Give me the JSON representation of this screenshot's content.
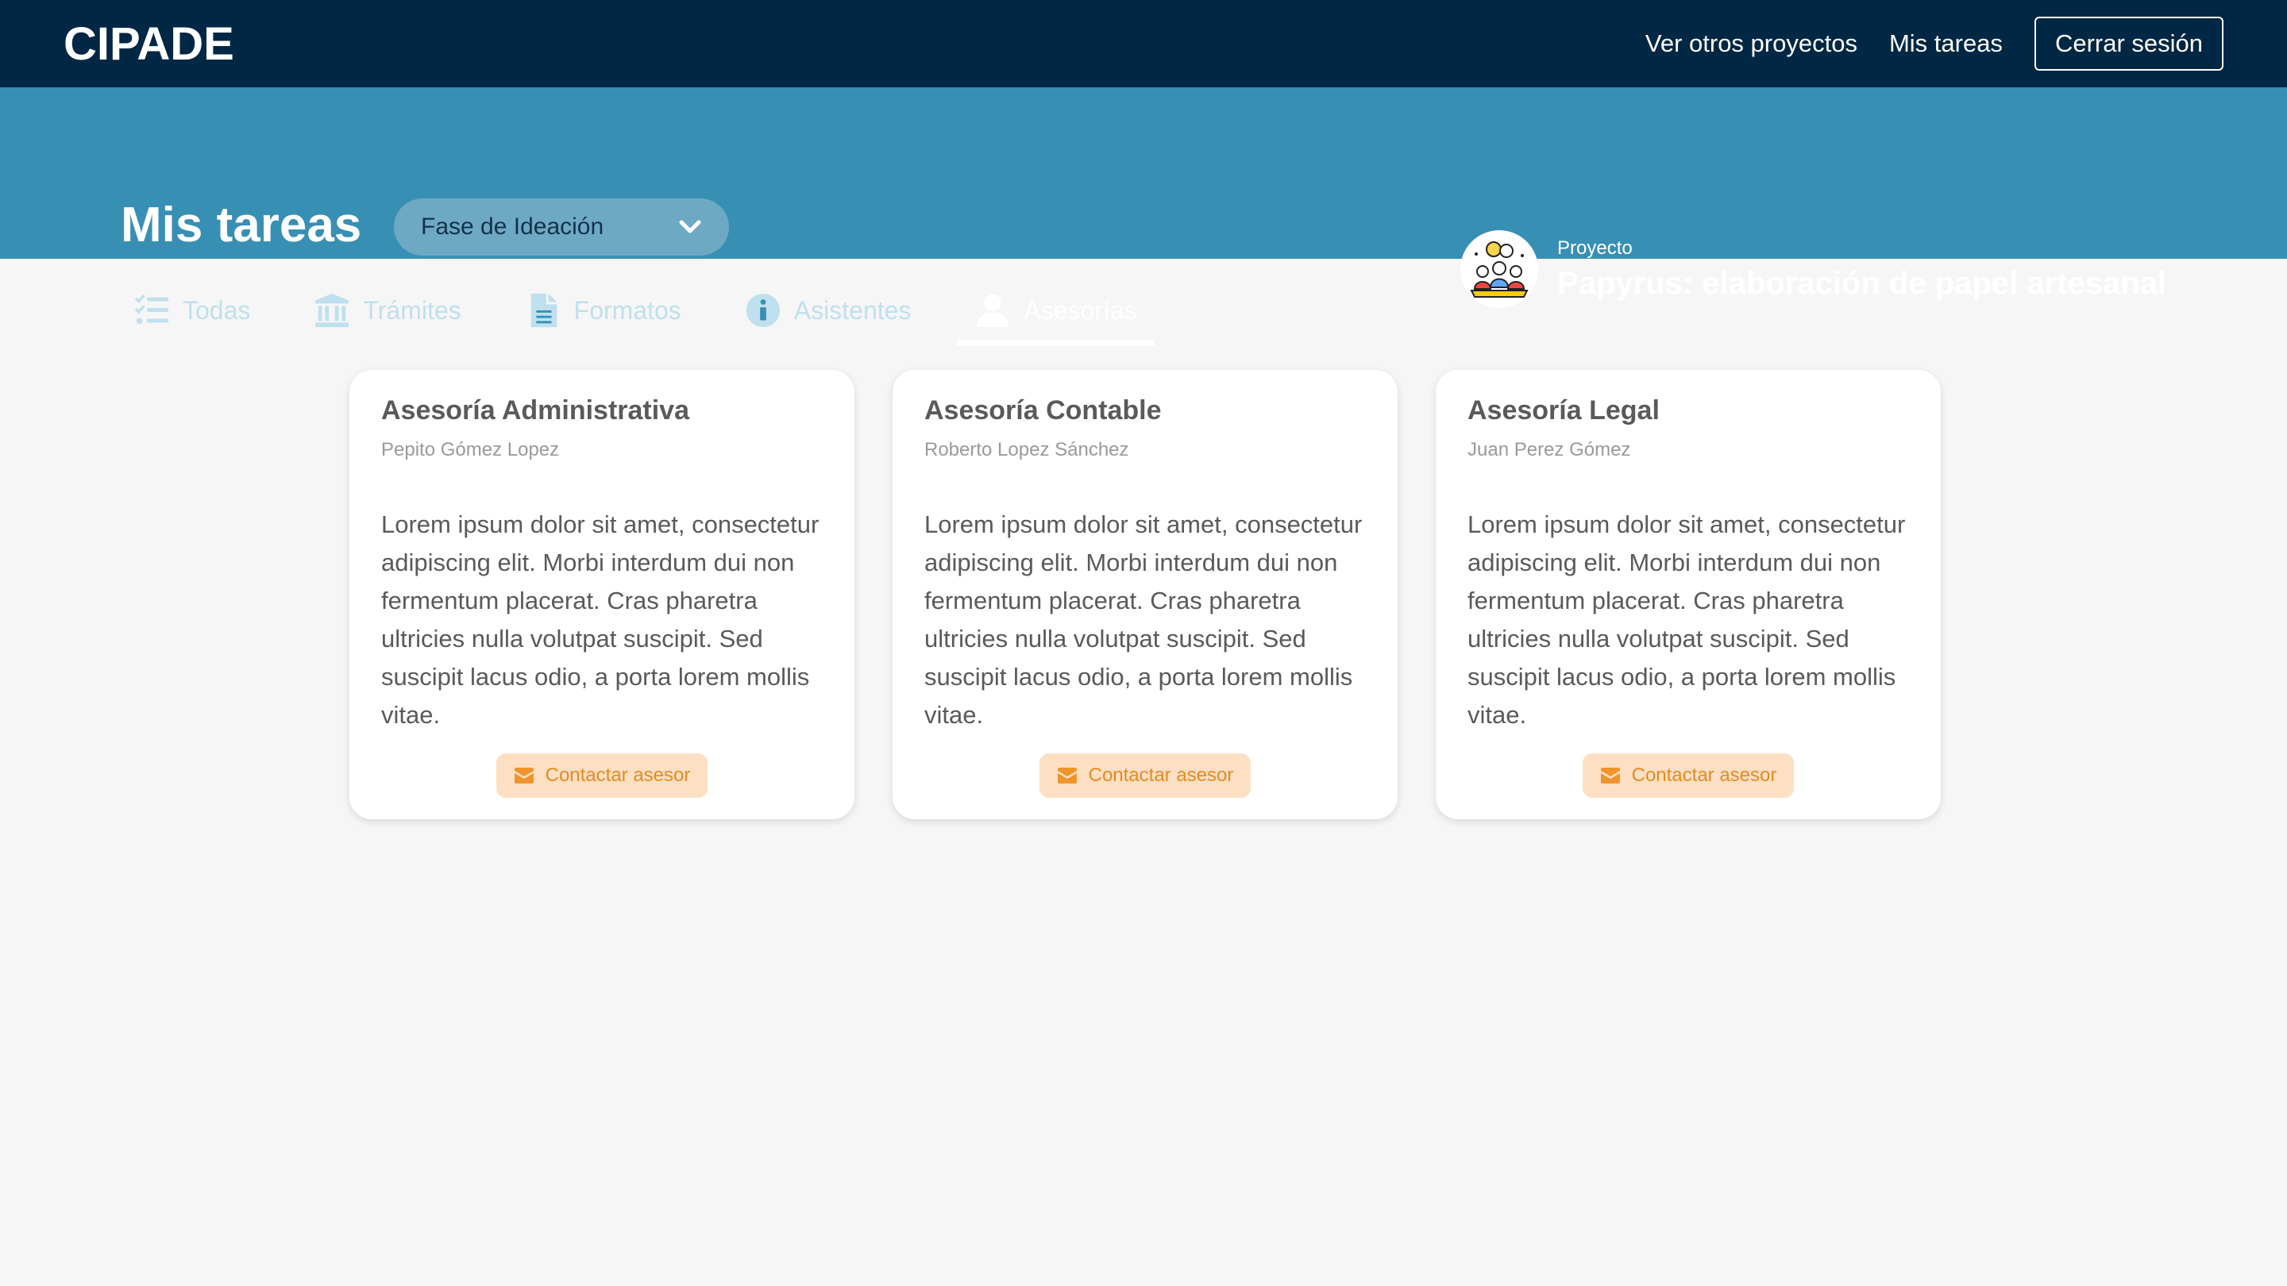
{
  "topbar": {
    "brand": "CIPADE",
    "nav": [
      {
        "label": "Ver otros proyectos"
      },
      {
        "label": "Mis tareas"
      }
    ],
    "logout_label": "Cerrar sesión"
  },
  "header": {
    "title": "Mis tareas",
    "phase_select": {
      "value": "Fase de Ideación"
    },
    "tabs": [
      {
        "label": "Todas",
        "icon": "checklist-icon"
      },
      {
        "label": "Trámites",
        "icon": "bank-icon"
      },
      {
        "label": "Formatos",
        "icon": "document-icon"
      },
      {
        "label": "Asistentes",
        "icon": "info-icon"
      },
      {
        "label": "Asesorías",
        "icon": "user-icon",
        "active": true
      }
    ],
    "project": {
      "label": "Proyecto",
      "name": "Papyrus: elaboración de papel artesanal"
    }
  },
  "cards": [
    {
      "title": "Asesoría Administrativa",
      "advisor": "Pepito Gómez Lopez",
      "body": "Lorem ipsum dolor sit amet, consectetur adipiscing elit. Morbi interdum dui non fermentum placerat. Cras pharetra ultricies nulla volutpat suscipit. Sed suscipit lacus odio, a porta lorem mollis vitae.",
      "button": "Contactar asesor"
    },
    {
      "title": "Asesoría Contable",
      "advisor": "Roberto Lopez Sánchez",
      "body": "Lorem ipsum dolor sit amet, consectetur adipiscing elit. Morbi interdum dui non fermentum placerat. Cras pharetra ultricies nulla volutpat suscipit. Sed suscipit lacus odio, a porta lorem mollis vitae.",
      "button": "Contactar asesor"
    },
    {
      "title": "Asesoría Legal",
      "advisor": "Juan Perez Gómez",
      "body": "Lorem ipsum dolor sit amet, consectetur adipiscing elit. Morbi interdum dui non fermentum placerat. Cras pharetra ultricies nulla volutpat suscipit. Sed suscipit lacus odio, a porta lorem mollis vitae.",
      "button": "Contactar asesor"
    }
  ],
  "colors": {
    "topbar": "#002744",
    "subheader": "#388fb4",
    "background": "#f6f6f6",
    "contact_button_bg": "#fde0c4",
    "contact_button_text": "#e8891f"
  }
}
